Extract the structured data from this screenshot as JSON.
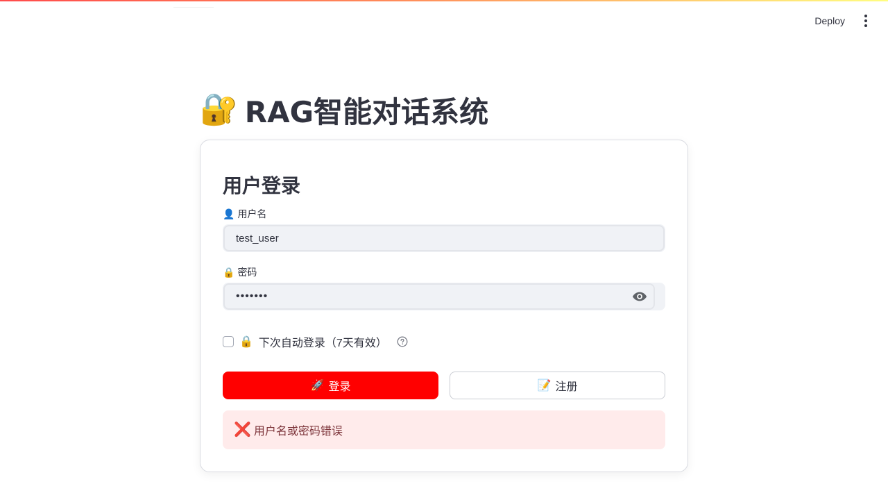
{
  "header": {
    "deploy_label": "Deploy",
    "menu_icon": "more-vert-icon"
  },
  "app": {
    "title_icon": "🔐",
    "title": "RAG智能对话系统"
  },
  "login_form": {
    "heading": "用户登录",
    "username": {
      "label_icon": "👤",
      "label": "用户名",
      "value": "test_user"
    },
    "password": {
      "label_icon": "🔒",
      "label": "密码",
      "value": "•••••••",
      "toggle_icon": "eye-icon"
    },
    "remember": {
      "icon": "🔒",
      "label": "下次自动登录（7天有效）",
      "checked": false,
      "help_icon": "question-circle-icon"
    },
    "login_button": {
      "icon": "🚀",
      "label": "登录",
      "color": "#ff0000"
    },
    "register_button": {
      "icon": "📝",
      "label": "注册"
    },
    "error": {
      "icon": "❌",
      "message": "用户名或密码错误",
      "background": "#ffebeb"
    }
  }
}
